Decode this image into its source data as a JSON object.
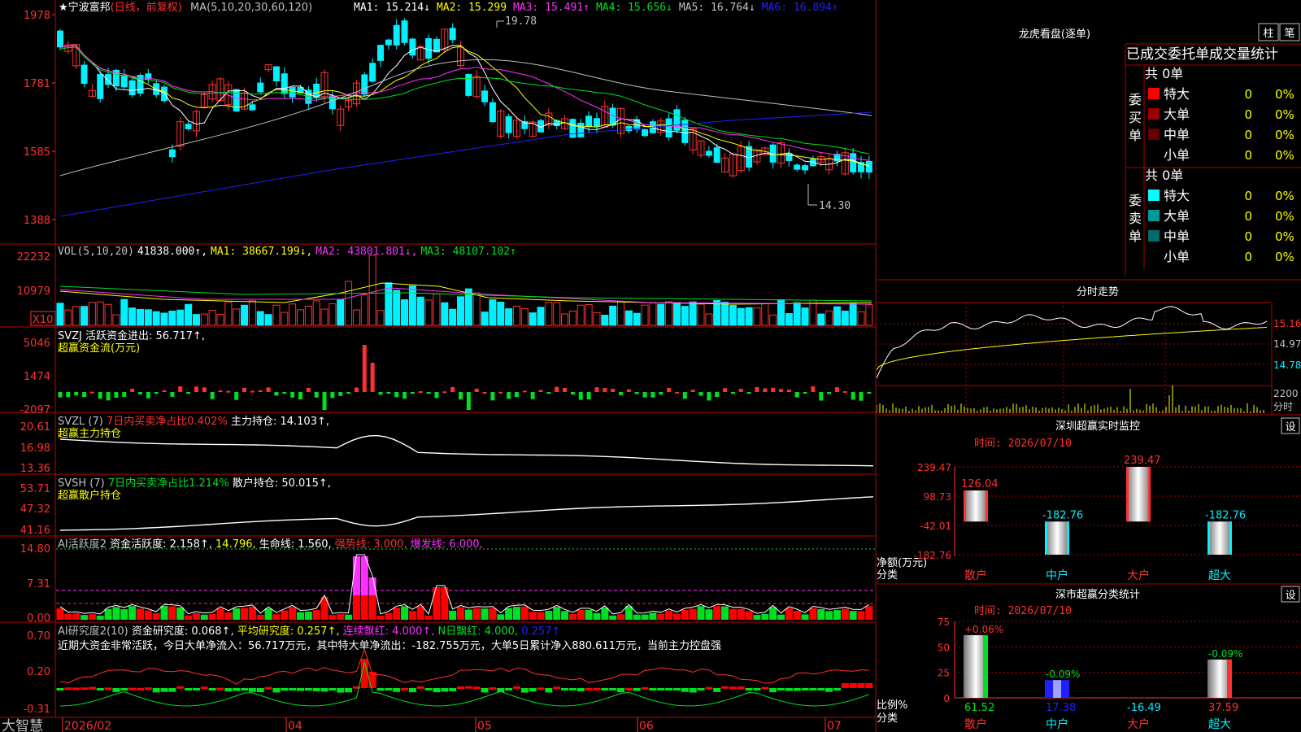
{
  "app_name": "大智慧",
  "stock": {
    "star": "★",
    "name": "宁波富邦",
    "mode": "(日线，前复权)"
  },
  "colors": {
    "red": "#ff3030",
    "cyan": "#00f0ff",
    "green": "#00e020",
    "magenta": "#ff30ff",
    "yellow": "#ffff00",
    "blue": "#1818ff",
    "grid": "#b00000"
  },
  "main_chart": {
    "legend_prefix": "MA(5,10,20,30,60,120)",
    "ma_items": [
      {
        "label": "MA1: 15.214↓",
        "color": "#ffffff"
      },
      {
        "label": "MA2: 15.299",
        "color": "#ffff00"
      },
      {
        "label": "MA3: 15.491↑",
        "color": "#ff30ff"
      },
      {
        "label": "MA4: 15.656↓",
        "color": "#00e020"
      },
      {
        "label": "MA5: 16.764↓",
        "color": "#c0c0c0"
      },
      {
        "label": "MA6: 16.894↑",
        "color": "#2020ff"
      }
    ],
    "y_ticks": [
      "1978",
      "1781",
      "1585",
      "1388"
    ],
    "high_label": "19.78",
    "low_label": "14.30"
  },
  "volume": {
    "legend": [
      {
        "label": "VOL(5,10,20)",
        "color": "#c0c0c0"
      },
      {
        "label": "41838.000↑,",
        "color": "#ffffff"
      },
      {
        "label": "MA1: 38667.199↓,",
        "color": "#ffff00"
      },
      {
        "label": "MA2: 43801.801↓,",
        "color": "#ff30ff"
      },
      {
        "label": "MA3: 48107.102↑",
        "color": "#00e020"
      }
    ],
    "y_ticks": [
      "22232",
      "10979"
    ],
    "unit": "X10"
  },
  "svzj": {
    "line1": [
      {
        "label": "SVZJ  活跃资金进出: 56.717↑,",
        "color": "#ffffff"
      }
    ],
    "line2": [
      {
        "label": "超赢资金流(万元)",
        "color": "#ffff00"
      }
    ],
    "y_ticks": [
      "5046",
      "1474",
      "-2097"
    ]
  },
  "svzl": {
    "line1": [
      {
        "label": "SVZL (7)",
        "color": "#c0c0c0"
      },
      {
        "label": " 7日内买卖净占比0.402%",
        "color": "#ff3030"
      },
      {
        "label": " 主力持仓: 14.103↑,",
        "color": "#ffffff"
      }
    ],
    "line2": [
      {
        "label": "超赢主力持仓",
        "color": "#ffff00"
      }
    ],
    "y_ticks": [
      "20.61",
      "16.98",
      "13.36"
    ]
  },
  "svsh": {
    "line1": [
      {
        "label": "SVSH (7)",
        "color": "#c0c0c0"
      },
      {
        "label": " 7日内买卖净占比1.214%",
        "color": "#00e020"
      },
      {
        "label": " 散户持仓: 50.015↑,",
        "color": "#ffffff"
      }
    ],
    "line2": [
      {
        "label": "超赢散户持仓",
        "color": "#ffff00"
      }
    ],
    "y_ticks": [
      "53.71",
      "47.32",
      "41.16"
    ]
  },
  "ai_active": {
    "line1": [
      {
        "label": "AI活跃度2",
        "color": "#c0c0c0"
      },
      {
        "label": " 资金活跃度: 2.158↑,",
        "color": "#ffffff"
      },
      {
        "label": " 14.796,",
        "color": "#ffff00"
      },
      {
        "label": " 生命线: 1.560,",
        "color": "#ffffff"
      },
      {
        "label": " 强势线: 3.000,",
        "color": "#ff3030"
      },
      {
        "label": " 爆发线: 6.000,",
        "color": "#ff30ff"
      }
    ],
    "y_ticks": [
      "14.80",
      "7.31",
      "0.00"
    ]
  },
  "ai_research": {
    "line1": [
      {
        "label": "AI研究度2(10)",
        "color": "#c0c0c0"
      },
      {
        "label": " 资金研究度: 0.068↑,",
        "color": "#ffffff"
      },
      {
        "label": " 平均研究度: 0.257↑,",
        "color": "#ffff00"
      },
      {
        "label": " 连续飘红: 4.000↑,",
        "color": "#ff30ff"
      },
      {
        "label": " N日飘红: 4.000,",
        "color": "#00e020"
      },
      {
        "label": " 0.257↑",
        "color": "#2020ff"
      }
    ],
    "comment": "近期大资金非常活跃，今日大单净流入：56.717万元，其中特大单净流出：-182.755万元，大单5日累计净入880.611万元，当前主力控盘强",
    "y_ticks": [
      "0.70",
      "0.20",
      "-0.31"
    ]
  },
  "x_axis": {
    "labels": [
      "2026/02",
      "04",
      "05",
      "06",
      "07"
    ]
  },
  "order_panel": {
    "title": "龙虎看盘(逐单)",
    "btn_bar": "柱",
    "btn_pen": "笔",
    "header": "已成交委托单成交量统计",
    "buy": {
      "total": "共 0单",
      "side_label": "委买单",
      "rows": [
        {
          "label": "特大",
          "count": "0",
          "pct": "0%",
          "color": "#ff0000"
        },
        {
          "label": "大单",
          "count": "0",
          "pct": "0%",
          "color": "#990000"
        },
        {
          "label": "中单",
          "count": "0",
          "pct": "0%",
          "color": "#660000"
        },
        {
          "label": "小单",
          "count": "0",
          "pct": "0%",
          "color": ""
        }
      ]
    },
    "sell": {
      "total": "共 0单",
      "side_label": "委卖单",
      "rows": [
        {
          "label": "特大",
          "count": "0",
          "pct": "0%",
          "color": "#00ffff"
        },
        {
          "label": "大单",
          "count": "0",
          "pct": "0%",
          "color": "#009999"
        },
        {
          "label": "中单",
          "count": "0",
          "pct": "0%",
          "color": "#006b6b"
        },
        {
          "label": "小单",
          "count": "0",
          "pct": "0%",
          "color": ""
        }
      ]
    }
  },
  "intraday": {
    "title": "分时走势",
    "price_ticks": [
      "15.16",
      "14.97",
      "14.78"
    ],
    "volume_tick": "2200",
    "volume_label": "分时"
  },
  "realtime_monitor": {
    "title": "深圳超赢实时监控",
    "settings": "设",
    "date_label": "时间: 2026/07/10",
    "y_label": "净额(万元)",
    "x_label": "分类",
    "chart_data": {
      "type": "bar",
      "categories": [
        "散户",
        "中户",
        "大户",
        "超大"
      ],
      "values": [
        126.04,
        -182.76,
        239.47,
        -182.76
      ],
      "value_labels": [
        "126.04",
        "-182.76",
        "239.47",
        "-182.76"
      ],
      "y_ticks": [
        239.47,
        98.73,
        -42.01,
        -182.76
      ],
      "y_tick_labels": [
        "239.47",
        "98.73",
        "-42.01",
        "-182.76"
      ],
      "ylim": [
        -182.76,
        239.47
      ]
    }
  },
  "class_stats": {
    "title": "深市超赢分类统计",
    "settings": "设",
    "date_label": "时间: 2026/07/10",
    "y_label": "比例%",
    "x_label": "分类",
    "chart_data": {
      "type": "bar",
      "categories": [
        "散户",
        "中户",
        "大户",
        "超大"
      ],
      "values": [
        61.52,
        17.38,
        -16.49,
        37.59
      ],
      "change_labels": [
        "+0.06%",
        "-0.09%",
        "",
        "-0.09%"
      ],
      "value_labels": [
        "61.52",
        "17.38",
        "-16.49",
        "37.59"
      ],
      "y_ticks": [
        75,
        50,
        25,
        0
      ],
      "y_tick_labels": [
        "75",
        "50",
        "25",
        "0"
      ],
      "ylim": [
        0,
        75
      ]
    }
  }
}
